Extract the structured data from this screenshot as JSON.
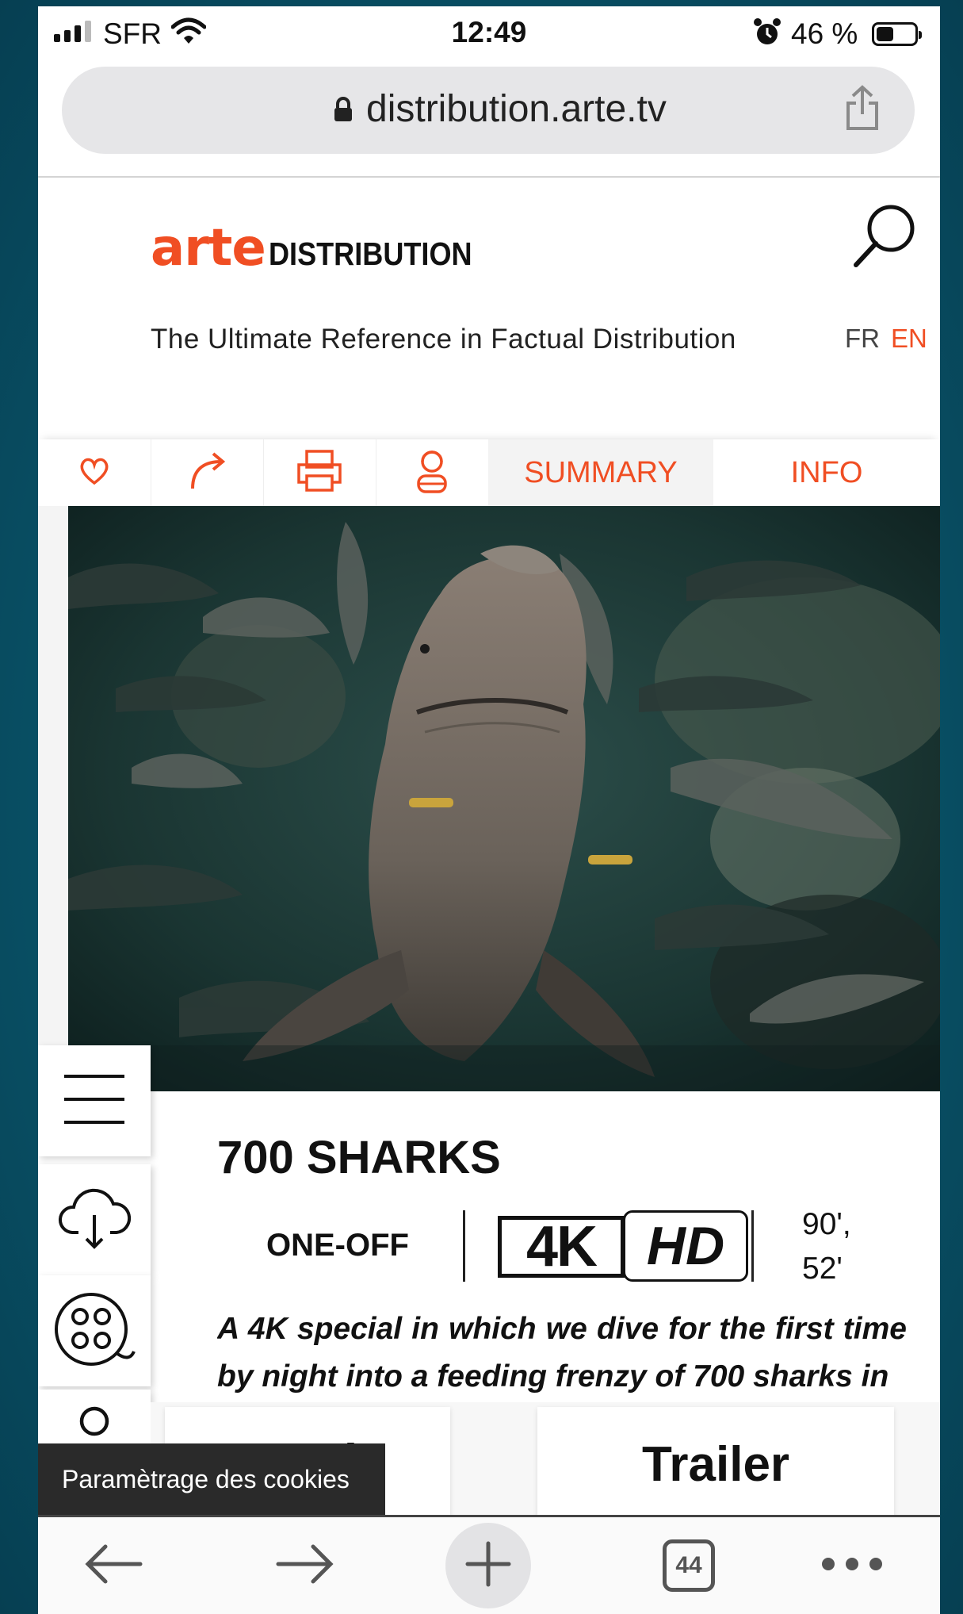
{
  "status_bar": {
    "carrier": "SFR",
    "time": "12:49",
    "battery_percent": "46 %",
    "battery_level": 0.46
  },
  "browser": {
    "url": "distribution.arte.tv",
    "tab_count": "44"
  },
  "site": {
    "logo_arte": "arte",
    "logo_distribution": "DISTRIBUTION",
    "tagline": "The Ultimate Reference in Factual Distribution",
    "lang_fr": "FR",
    "lang_en": "EN",
    "accent_color": "#f04e23"
  },
  "toolbar": {
    "icons": [
      "heart-icon",
      "share-arrow-icon",
      "print-icon",
      "contact-icon"
    ],
    "tab_summary": "SUMMARY",
    "tab_info": "INFO"
  },
  "side_menu": [
    "menu-icon",
    "cloud-download-icon",
    "film-reel-icon",
    "search-icon"
  ],
  "program": {
    "title": "700 SHARKS",
    "format": "ONE-OFF",
    "badge_4k": "4K",
    "badge_hd": "HD",
    "duration_line1": "90',",
    "duration_line2": "52'",
    "description": "A 4K special in which we dive for the first time by night into a feeding frenzy of 700 sharks in",
    "watch_label": "Watch",
    "trailer_label": "Trailer"
  },
  "cookie_banner": "Paramètrage des cookies"
}
